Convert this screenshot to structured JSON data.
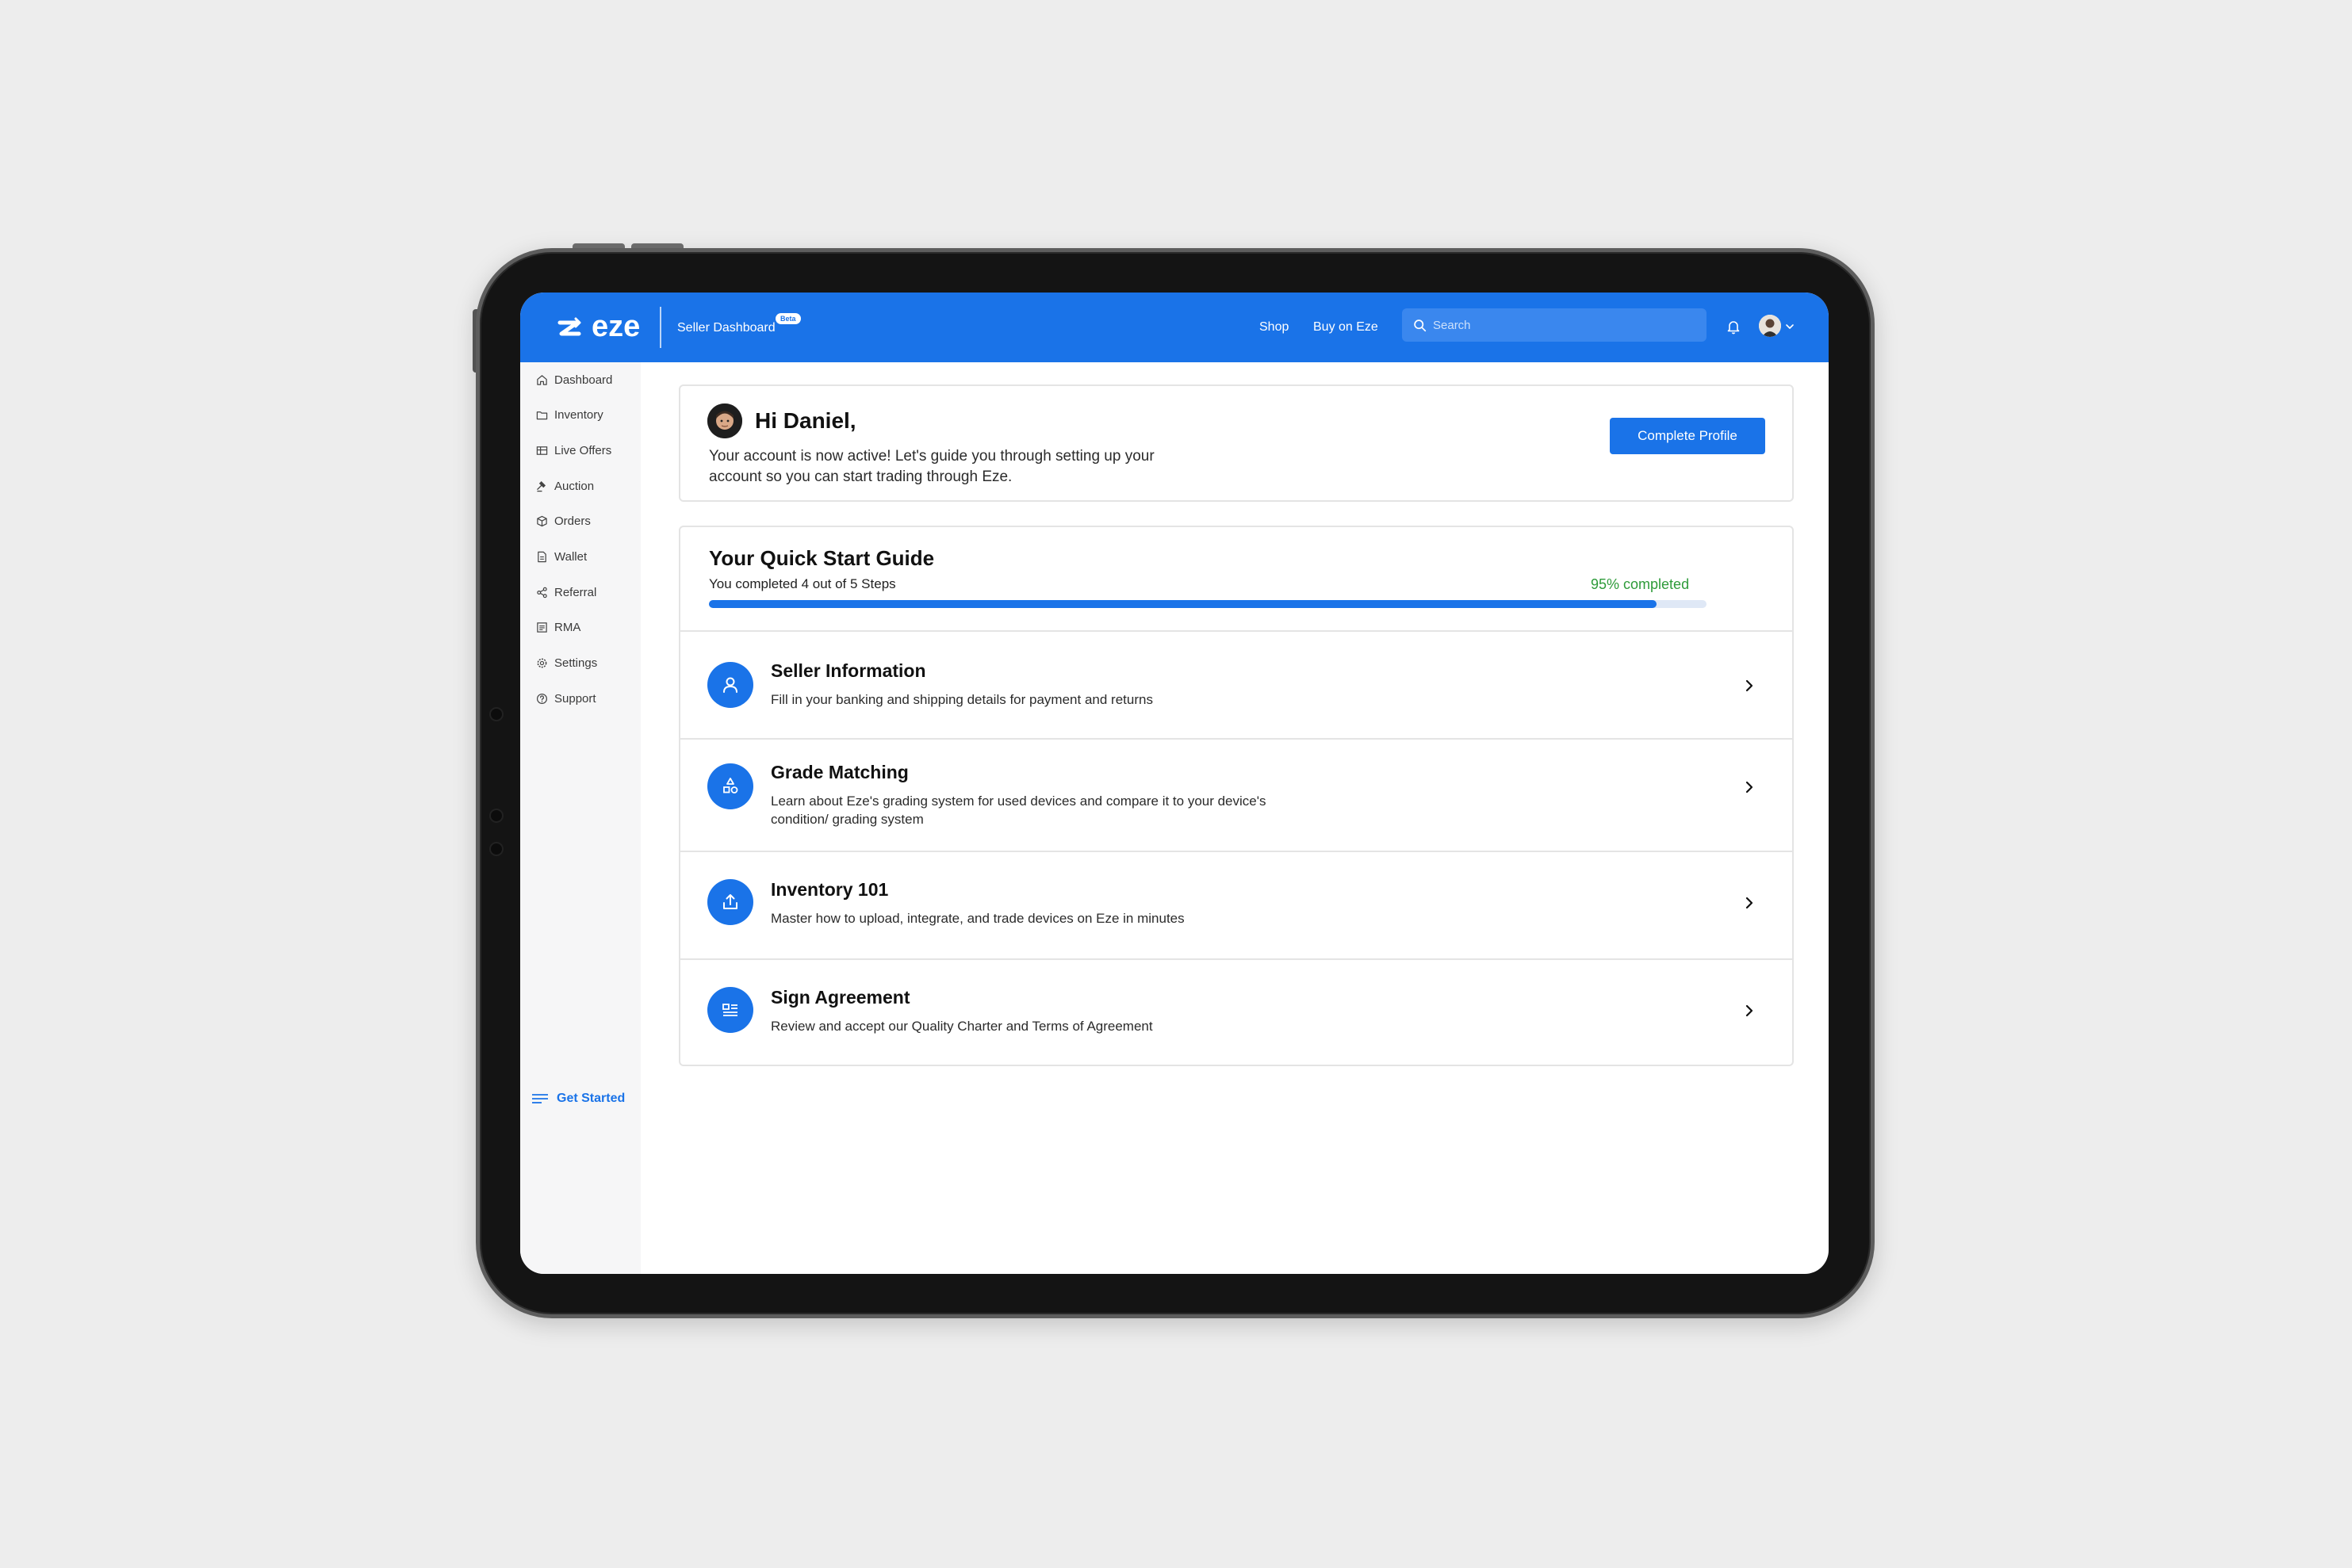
{
  "colors": {
    "brand": "#1a73e8",
    "success": "#2e9b3a"
  },
  "header": {
    "logo_text": "eze",
    "dashboard_title": "Seller Dashboard",
    "beta_badge": "Beta",
    "nav": [
      {
        "label": "Shop"
      },
      {
        "label": "Buy on Eze"
      }
    ],
    "search_placeholder": "Search",
    "icons": [
      "search-icon",
      "bell-icon",
      "avatar",
      "chevron-down-icon"
    ]
  },
  "sidebar": {
    "items": [
      {
        "label": "Dashboard",
        "icon": "home-icon"
      },
      {
        "label": "Inventory",
        "icon": "folder-icon"
      },
      {
        "label": "Live Offers",
        "icon": "offers-icon"
      },
      {
        "label": "Auction",
        "icon": "gavel-icon"
      },
      {
        "label": "Orders",
        "icon": "box-icon"
      },
      {
        "label": "Wallet",
        "icon": "wallet-icon"
      },
      {
        "label": "Referral",
        "icon": "share-icon"
      },
      {
        "label": "RMA",
        "icon": "document-icon"
      },
      {
        "label": "Settings",
        "icon": "gear-icon"
      },
      {
        "label": "Support",
        "icon": "help-icon"
      }
    ],
    "get_started": "Get Started"
  },
  "welcome": {
    "title": "Hi Daniel,",
    "message": "Your account is now active! Let's guide you through setting up your account so you can start trading through Eze.",
    "button_label": "Complete Profile"
  },
  "guide": {
    "title": "Your Quick Start Guide",
    "subtitle": "You completed 4 out of 5 Steps",
    "percent_label": "95% completed",
    "progress": 0.95,
    "steps": [
      {
        "title": "Seller Information",
        "description": "Fill in your banking and shipping details for payment and returns",
        "icon": "user-icon"
      },
      {
        "title": "Grade Matching",
        "description": "Learn about Eze's grading system for used devices and compare it to your device's condition/ grading system",
        "icon": "shapes-icon"
      },
      {
        "title": "Inventory 101",
        "description": "Master how to upload, integrate, and trade devices on Eze in minutes",
        "icon": "upload-icon"
      },
      {
        "title": "Sign Agreement",
        "description": "Review and accept our Quality Charter and Terms of Agreement",
        "icon": "agreement-icon"
      }
    ]
  }
}
